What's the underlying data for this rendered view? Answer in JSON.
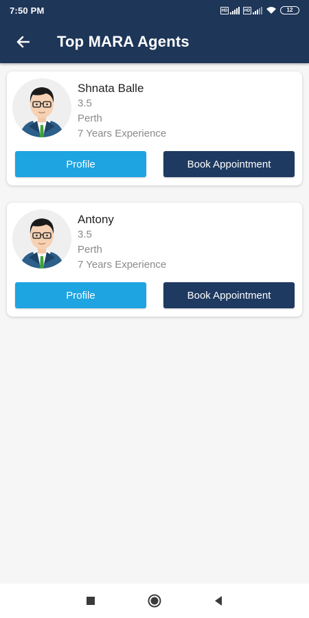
{
  "status_bar": {
    "time": "7:50 PM",
    "battery": "12"
  },
  "app_bar": {
    "title": "Top MARA Agents"
  },
  "agents": [
    {
      "name": "Shnata Balle",
      "rating": "3.5",
      "location": "Perth",
      "experience": "7 Years Experience",
      "profile_label": "Profile",
      "book_label": "Book Appointment"
    },
    {
      "name": "Antony",
      "rating": "3.5",
      "location": "Perth",
      "experience": "7 Years Experience",
      "profile_label": "Profile",
      "book_label": "Book Appointment"
    }
  ],
  "colors": {
    "primary": "#1e3658",
    "profile_button": "#1ea4e1",
    "book_button": "#1f3a61"
  },
  "icons": {
    "back": "arrow-left-icon",
    "recents": "square-icon",
    "home": "circle-icon",
    "back_nav": "triangle-left-icon"
  }
}
